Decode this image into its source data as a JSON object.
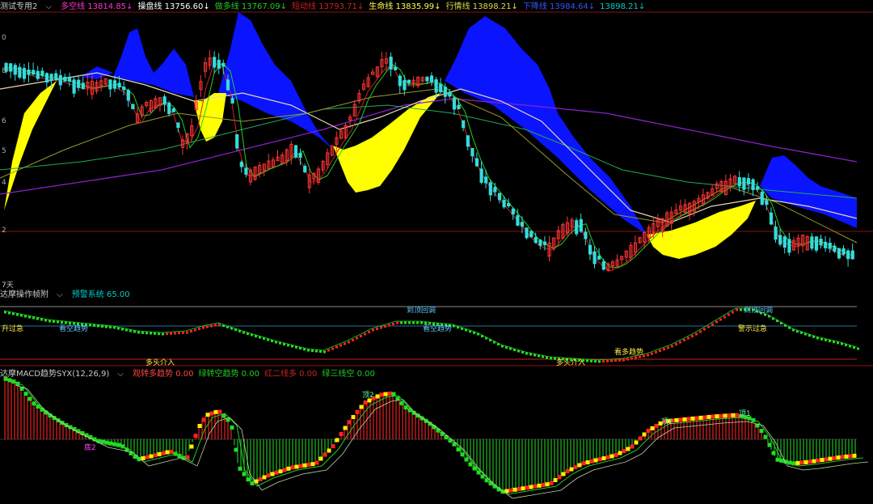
{
  "main_header": {
    "name": "测试专用2",
    "items": [
      {
        "label": "多空线",
        "value": "13814.85",
        "arrow": "↓",
        "color": "#ff33cc"
      },
      {
        "label": "操盘线",
        "value": "13756.60",
        "arrow": "↓",
        "color": "#ffffff"
      },
      {
        "label": "做多线",
        "value": "13767.09",
        "arrow": "↓",
        "color": "#22cc22"
      },
      {
        "label": "短动线",
        "value": "13793.71",
        "arrow": "↓",
        "color": "#cc2222"
      },
      {
        "label": "生命线",
        "value": "13835.99",
        "arrow": "↓",
        "color": "#ffff44"
      },
      {
        "label": "行情线",
        "value": "13898.21",
        "arrow": "↓",
        "color": "#dddd44"
      },
      {
        "label": "下降线",
        "value": "13984.64",
        "arrow": "↓",
        "color": "#3355ff"
      },
      {
        "label": "",
        "value": "13898.21",
        "arrow": "↓",
        "color": "#00cccc"
      }
    ]
  },
  "main_axis_ticks": [
    "0",
    "8",
    "6",
    "5",
    "4",
    "2"
  ],
  "period_label": "7天",
  "sub1_header": {
    "name": "达摩操作帧附",
    "items": [
      {
        "label": "预警系统",
        "value": "65.00",
        "color": "#00cccc"
      }
    ]
  },
  "sub1_annotations": [
    {
      "text": "升过急",
      "color": "#ffee44"
    },
    {
      "text": "看空趋势",
      "color": "#66ccff"
    },
    {
      "text": "到顶回调",
      "color": "#66ccff"
    },
    {
      "text": "看空趋势",
      "color": "#66ccff"
    },
    {
      "text": "多头介入",
      "color": "#ffee44"
    },
    {
      "text": "多头介入",
      "color": "#ffee44"
    },
    {
      "text": "看多趋势",
      "color": "#ffee44"
    },
    {
      "text": "到顶回调",
      "color": "#66ccff"
    },
    {
      "text": "警示过急",
      "color": "#ffee44"
    }
  ],
  "sub2_header": {
    "name": "达摩MACD趋势SYX(12,26,9)",
    "items": [
      {
        "label": "观转多趋势",
        "value": "0.00",
        "color": "#ff4444"
      },
      {
        "label": "绿转空趋势",
        "value": "0.00",
        "color": "#22cc22"
      },
      {
        "label": "红二线多",
        "value": "0.00",
        "color": "#cc2222"
      },
      {
        "label": "绿三线空",
        "value": "0.00",
        "color": "#22cc22"
      }
    ]
  },
  "sub2_annotations": [
    {
      "text": "底2",
      "color": "#ff44ff"
    },
    {
      "text": "顶2",
      "color": "#66ffaa"
    },
    {
      "text": "顶2",
      "color": "#66ffaa"
    },
    {
      "text": "顶1",
      "color": "#66ffaa"
    }
  ],
  "colors": {
    "up": "#ff3333",
    "down": "#33dddd",
    "cloud_bear": "#0a14ff",
    "cloud_bull": "#ffff00",
    "long_ma": "#8822cc",
    "grid_red": "#8a1010"
  }
}
